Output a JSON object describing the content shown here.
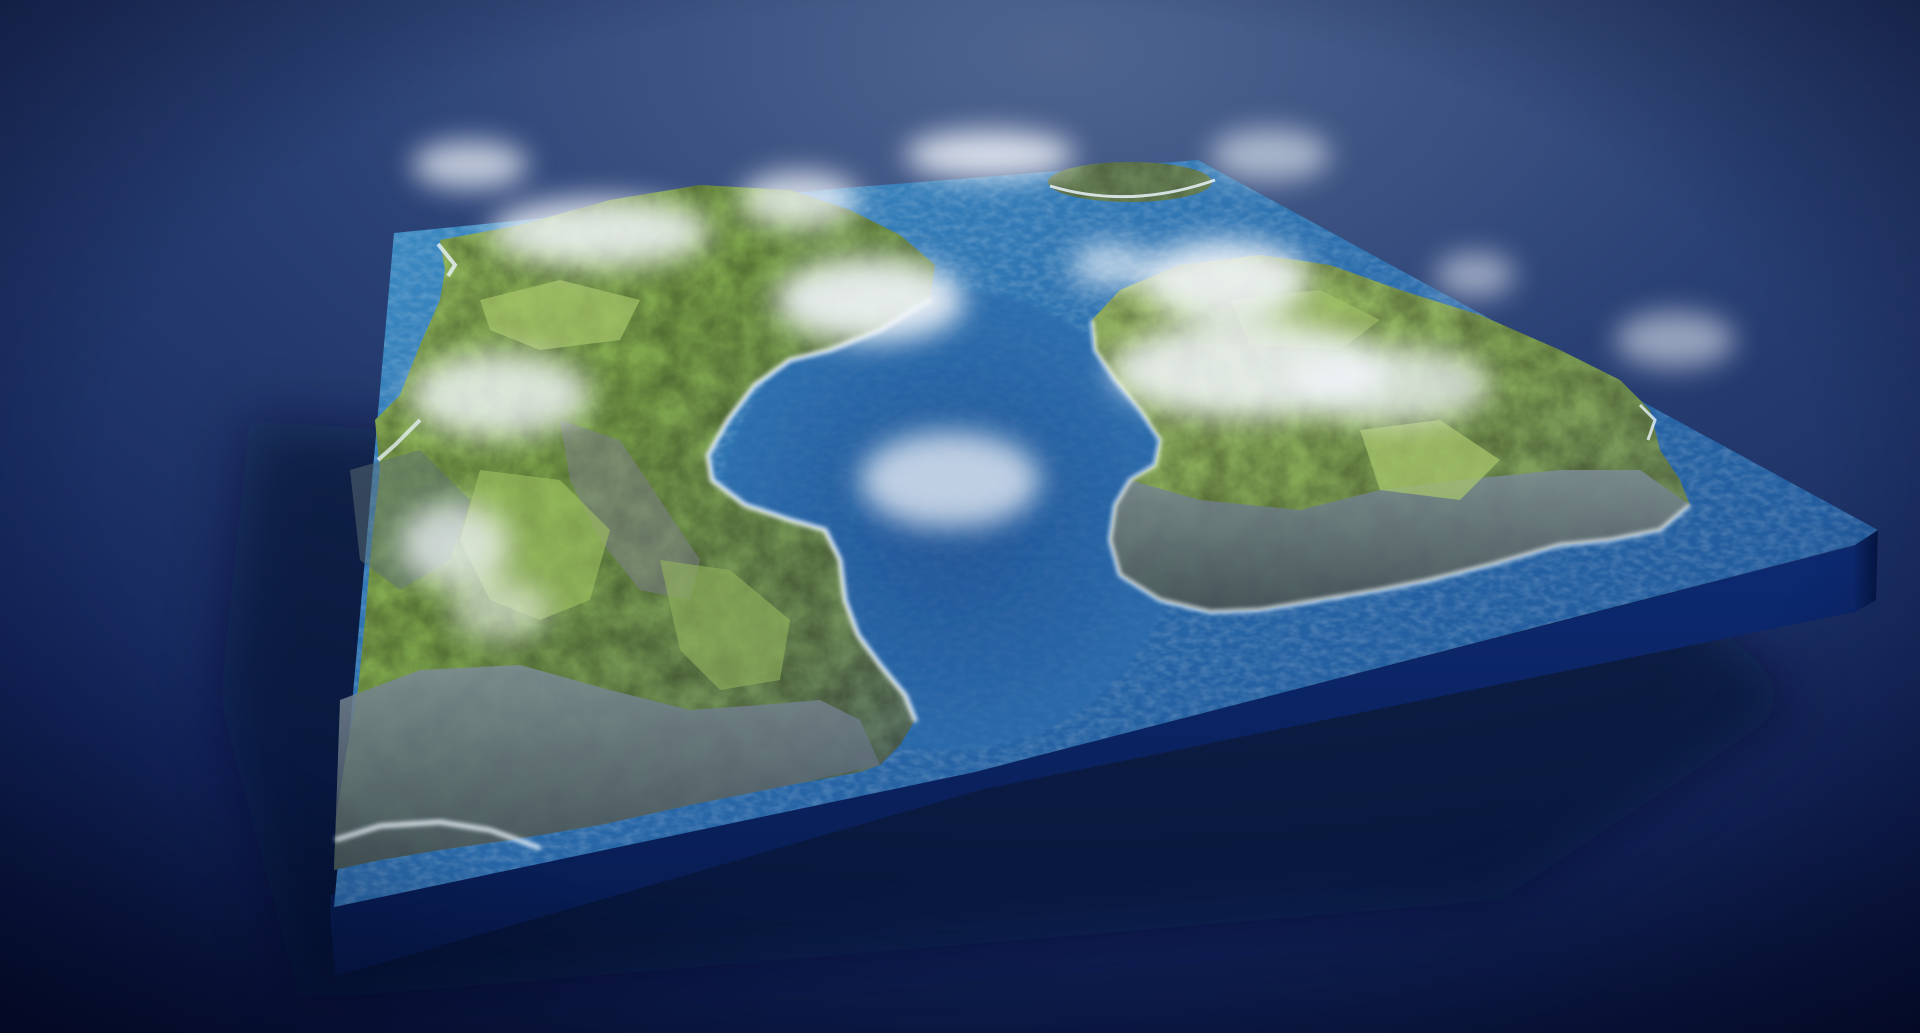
{
  "scene": {
    "subject": "",
    "colors": {
      "background_top": "#4a5e88",
      "background_mid": "#1e3466",
      "background_bottom": "#08143a",
      "slab_side": "#0a2266",
      "slab_side_dark": "#061844",
      "ocean_deep": "#1d4f93",
      "ocean_shallow": "#3f8fc4",
      "land_green": "#7aa34a",
      "land_light": "#a9c46a",
      "cliff_gray": "#6f7f8c",
      "cliff_dark": "#44525e",
      "surf": "#eaf4fb",
      "cloud": "#f2f6fb"
    },
    "icons": {
      "landmass_west": "landmass-west-icon",
      "landmass_east": "landmass-east-icon",
      "islet_north": "islet-north-icon",
      "cloud": "cloud-icon"
    }
  }
}
